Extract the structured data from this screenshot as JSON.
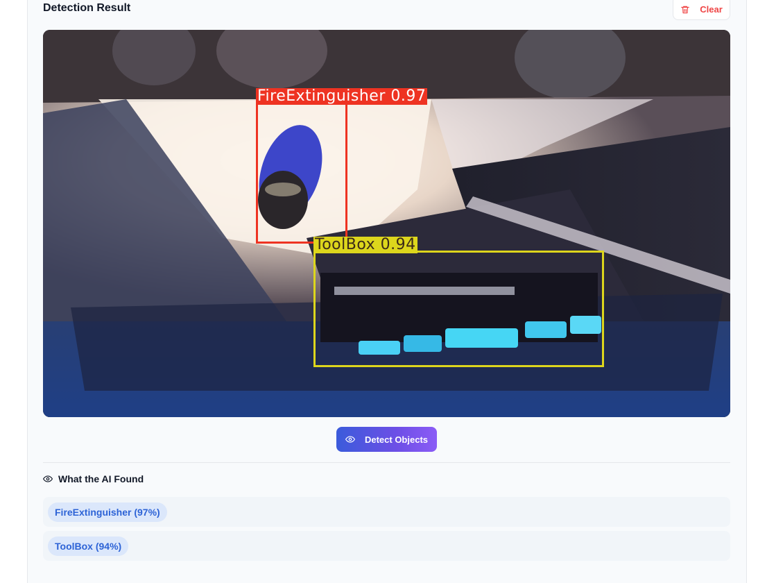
{
  "header": {
    "title": "Detection Result",
    "clear_label": "Clear",
    "clear_icon": "trash-icon"
  },
  "image": {
    "detections": [
      {
        "label": "FireExtinguisher 0.97",
        "color": "#ee3322"
      },
      {
        "label": "ToolBox 0.94",
        "color": "#ddd61c"
      }
    ]
  },
  "actions": {
    "detect_label": "Detect Objects",
    "detect_icon": "eye-icon"
  },
  "results": {
    "heading": "What the AI Found",
    "heading_icon": "eye-icon",
    "items": [
      {
        "text": "FireExtinguisher (97%)"
      },
      {
        "text": "ToolBox (94%)"
      }
    ]
  },
  "colors": {
    "accent_start": "#3b5bdb",
    "accent_end": "#8b5cf6",
    "danger": "#ef4444",
    "pill_text": "#2d63d6",
    "pill_bg": "#dbe7fb"
  }
}
